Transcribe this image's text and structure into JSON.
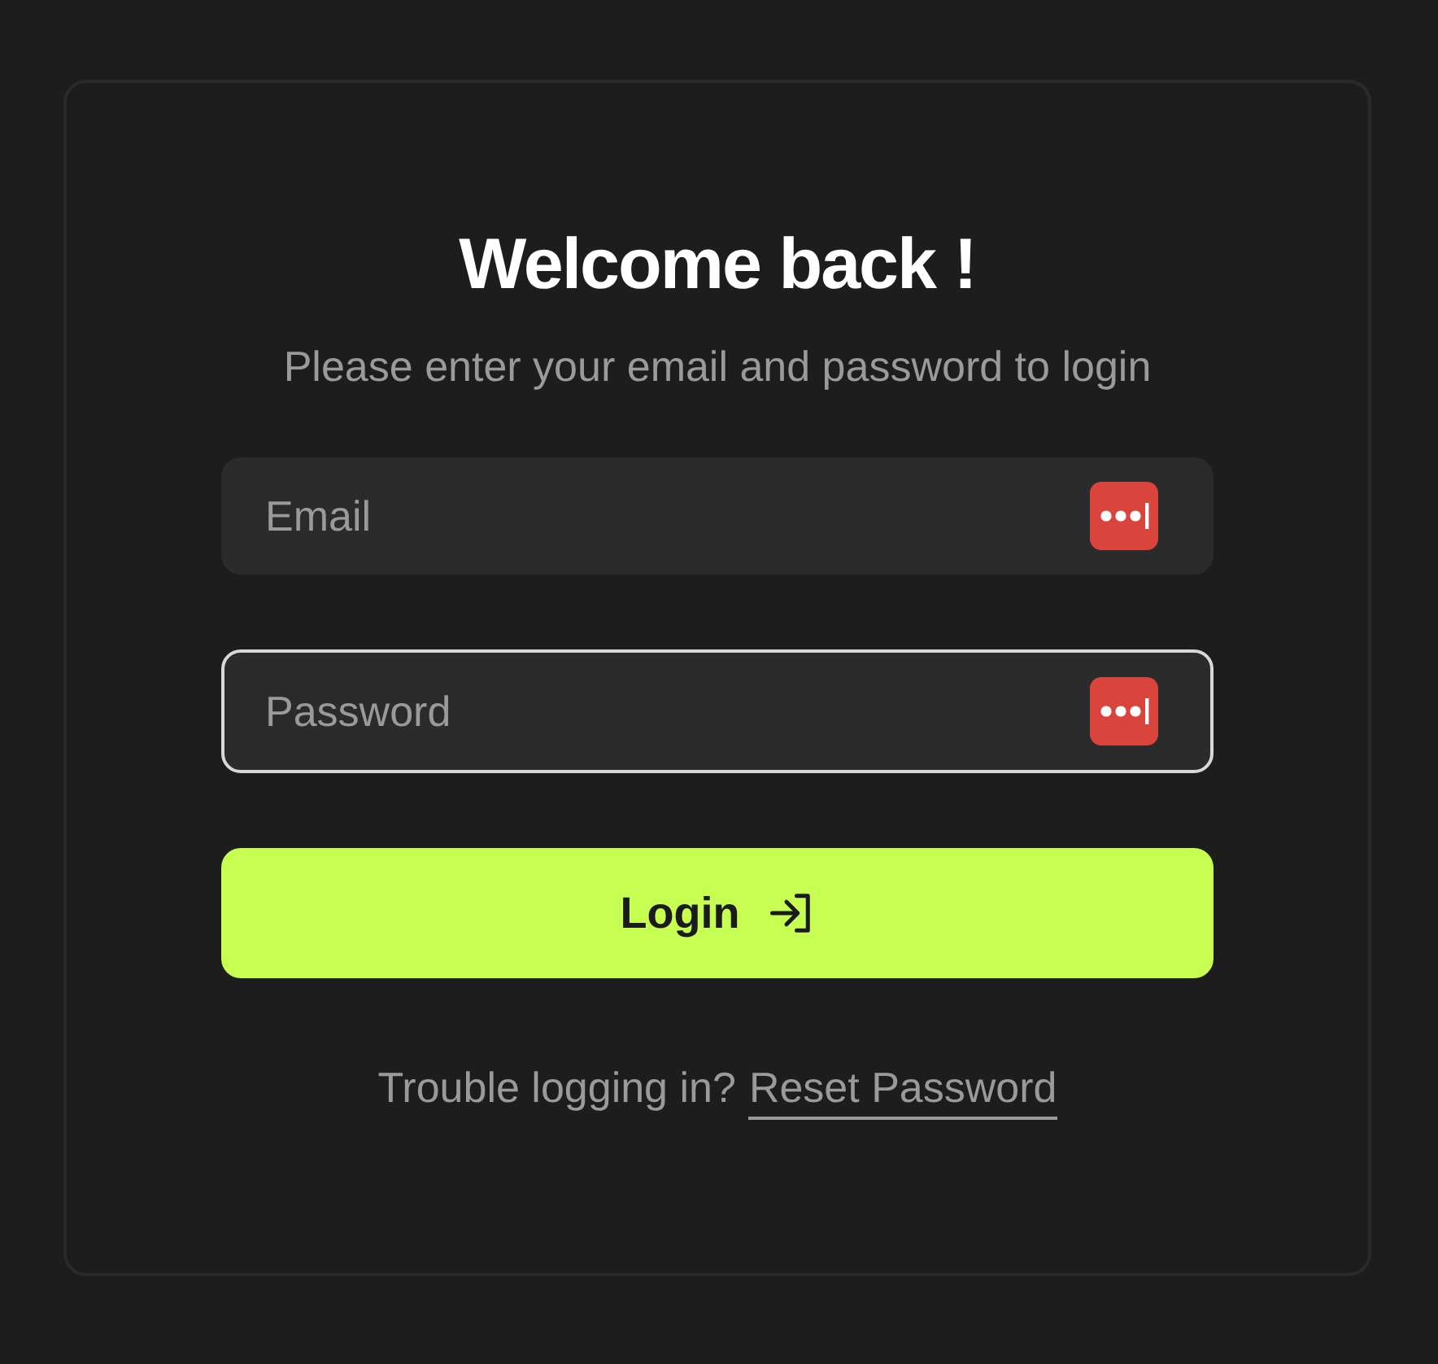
{
  "title": "Welcome back !",
  "subtitle": "Please enter your email and password to login",
  "fields": [
    {
      "placeholder": "Email",
      "focused": false
    },
    {
      "placeholder": "Password",
      "focused": true
    }
  ],
  "login_button": {
    "label": "Login"
  },
  "footer": {
    "text": "Trouble logging in?",
    "link": "Reset Password"
  }
}
